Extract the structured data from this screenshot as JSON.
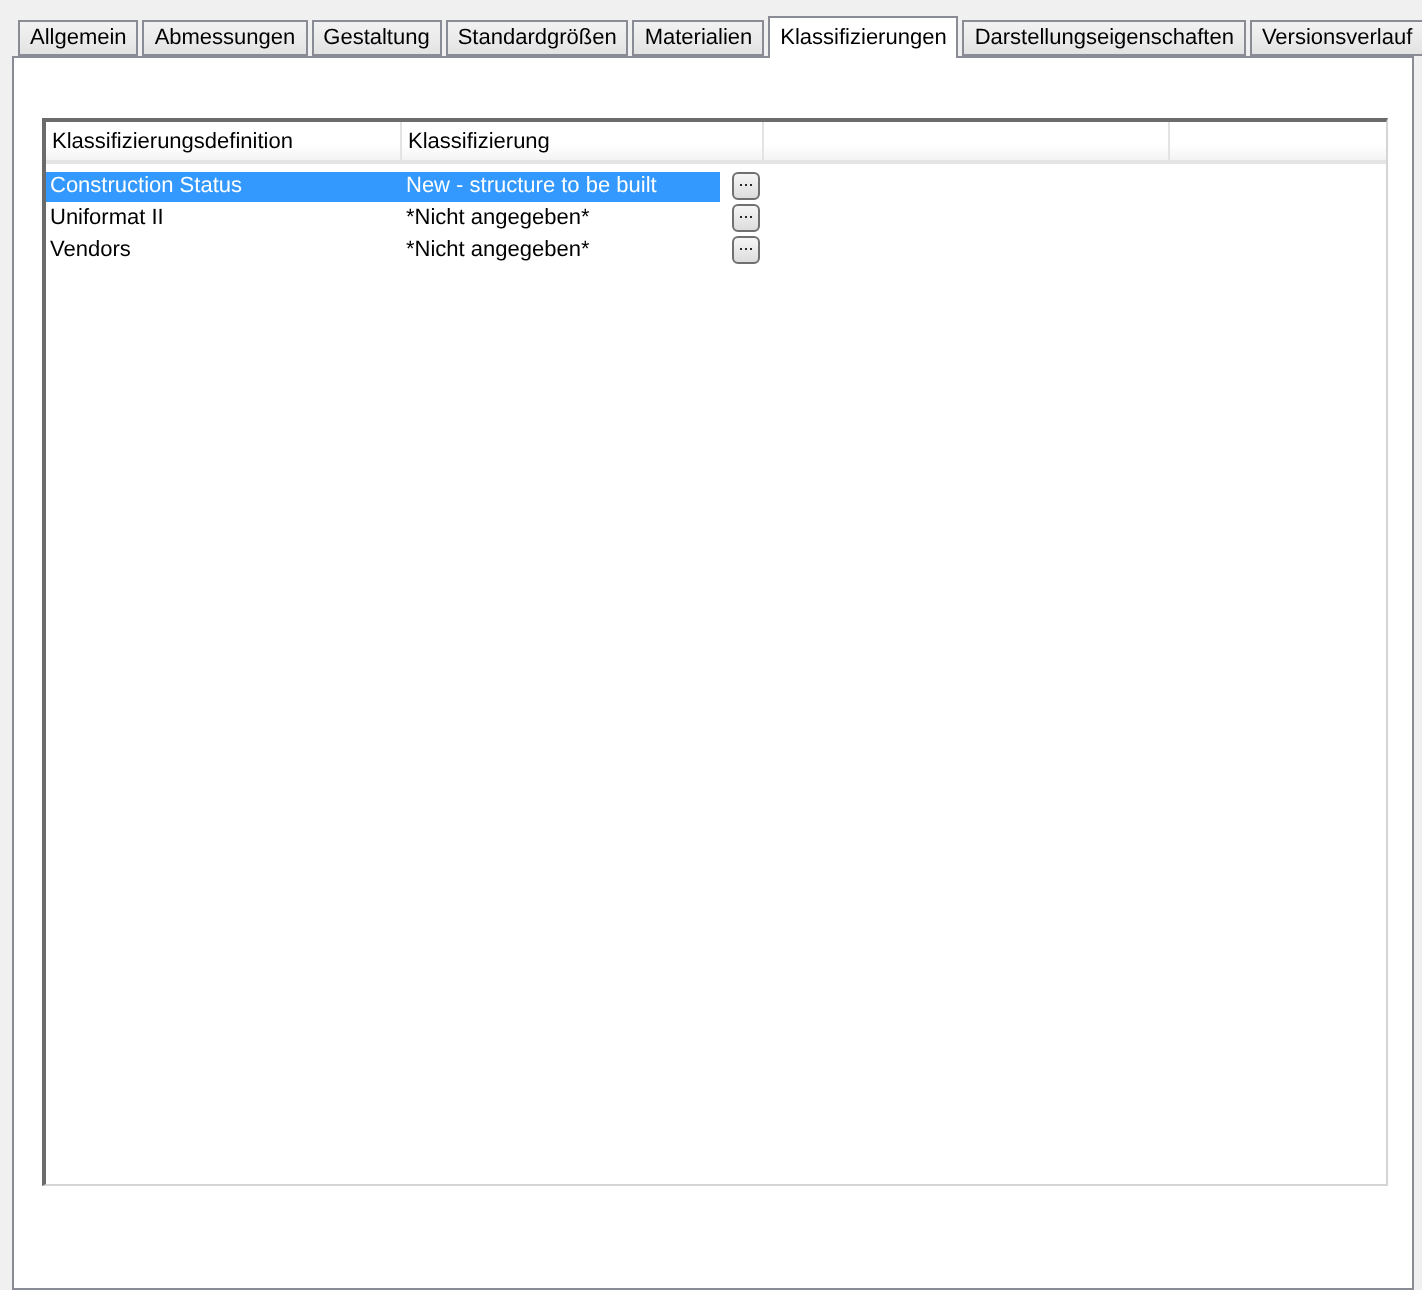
{
  "tabs": [
    {
      "label": "Allgemein",
      "selected": false
    },
    {
      "label": "Abmessungen",
      "selected": false
    },
    {
      "label": "Gestaltung",
      "selected": false
    },
    {
      "label": "Standardgrößen",
      "selected": false
    },
    {
      "label": "Materialien",
      "selected": false
    },
    {
      "label": "Klassifizierungen",
      "selected": true
    },
    {
      "label": "Darstellungseigenschaften",
      "selected": false
    },
    {
      "label": "Versionsverlauf",
      "selected": false
    }
  ],
  "table": {
    "columns": [
      "Klassifizierungsdefinition",
      "Klassifizierung"
    ],
    "rows": [
      {
        "definition": "Construction Status",
        "classification": "New - structure to be built",
        "button": "...",
        "selected": true
      },
      {
        "definition": "Uniformat II",
        "classification": "*Nicht angegeben*",
        "button": "...",
        "selected": false
      },
      {
        "definition": "Vendors",
        "classification": "*Nicht angegeben*",
        "button": "...",
        "selected": false
      }
    ]
  }
}
